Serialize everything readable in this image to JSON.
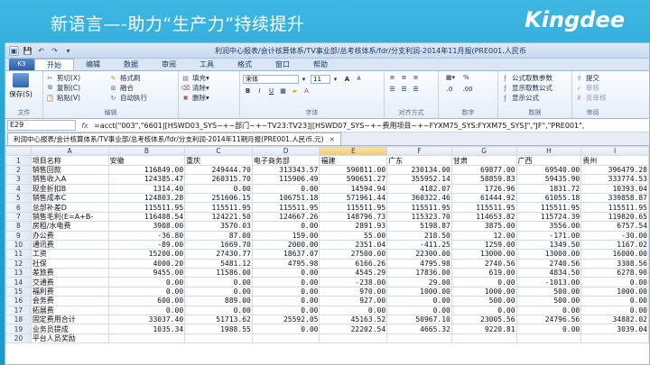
{
  "slide": {
    "title": "新语言—-助力“生产力”持续提升",
    "brand": "Kingdee"
  },
  "window": {
    "title": "利润中心报表/会计核算体系/TV事业部/总考核体系/fdr/分支利润-2014年11月报(PRE001.人民币"
  },
  "ribbon": {
    "app_button": "K3",
    "tabs": [
      "开始",
      "编辑",
      "数据",
      "审阅",
      "工具",
      "格式",
      "窗口",
      "帮助"
    ],
    "active_tab": "开始",
    "save_label": "保存(S)",
    "file_group": "文件",
    "edit_group": "编辑",
    "font_group": "字体",
    "align_group": "对齐方式",
    "number_group": "数字",
    "data_group": "数据",
    "review_group": "审阅",
    "cut": "剪切(X)",
    "copy": "复制(C)",
    "paste": "粘贴(V)",
    "format_painter": "格式刷",
    "merge": "融合",
    "wrap": "自动执行",
    "fill": "填充",
    "clear": "清除",
    "delete": "删除",
    "font_name": "宋体",
    "font_size": "11",
    "font_grow": "A",
    "font_shrink": "A",
    "percent": "%",
    "formula_params": "公式取数参数",
    "show_formula": "显示取数公式",
    "show_formula2": "显示公式",
    "submit": "提交",
    "audit": "审核",
    "unaudit": "反审核"
  },
  "formula_bar": {
    "cell": "E29",
    "fx": "fx",
    "text": "=acct(\"003\",\"6601|[HSWD03_SYS~+~部门~+~TV23:TV23]|[HSWD07_SYS~+~费用项目~+~FYXM75_SYS:FYXM75_SYS]\",\"JF\",\"PRE001\","
  },
  "doc_tab": {
    "label": "利润中心报表/会计核算体系/TV事业部/总考核体系/fdr/分支利润-2014年11期月报(PRE001.人民币.元)",
    "close": "×"
  },
  "columns": [
    "A",
    "B",
    "C",
    "D",
    "E",
    "F",
    "G",
    "H",
    "I"
  ],
  "rows": [
    {
      "n": "1",
      "cells": [
        "项目名称",
        "安徽",
        "重庆",
        "电子商务部",
        "福建",
        "广东",
        "甘肃",
        "广西",
        "贵州"
      ]
    },
    {
      "n": "2",
      "cells": [
        "销售回款",
        "116849.00",
        "249444.70",
        "313343.57",
        "590811.00",
        "230134.00",
        "69877.00",
        "69540.00",
        "396479.28"
      ]
    },
    {
      "n": "3",
      "cells": [
        "销售收入A",
        "124385.47",
        "260315.70",
        "115906.49",
        "590651.27",
        "355952.14",
        "58859.83",
        "59435.90",
        "333774.53"
      ]
    },
    {
      "n": "4",
      "cells": [
        "现金折扣B",
        "1314.40",
        "0.00",
        "0.00",
        "14594.94",
        "4182.07",
        "1726.96",
        "1831.72",
        "10393.04"
      ]
    },
    {
      "n": "5",
      "cells": [
        "销售成本C",
        "124803.28",
        "251606.15",
        "106751.18",
        "571961.44",
        "360322.46",
        "61444.92",
        "61055.18",
        "339858.87"
      ]
    },
    {
      "n": "6",
      "cells": [
        "总部补差D",
        "115511.95",
        "115511.95",
        "115511.95",
        "115511.95",
        "115511.95",
        "115511.95",
        "115511.95",
        "115511.95"
      ]
    },
    {
      "n": "7",
      "cells": [
        "销售毛利(E=A+B-",
        "116408.54",
        "124221.50",
        "124667.26",
        "148796.73",
        "115323.70",
        "114653.82",
        "115724.39",
        "119820.65"
      ]
    },
    {
      "n": "8",
      "cells": [
        "房租/水电费",
        "3908.00",
        "3570.03",
        "0.00",
        "2891.93",
        "5198.87",
        "3875.00",
        "3556.00",
        "6757.54"
      ]
    },
    {
      "n": "9",
      "cells": [
        "办公费",
        "-36.80",
        "87.00",
        "159.00",
        "55.00",
        "218.50",
        "12.00",
        "-171.00",
        "-30.00"
      ]
    },
    {
      "n": "10",
      "cells": [
        "通讯费",
        "-89.00",
        "1669.70",
        "2000.00",
        "2351.04",
        "-411.25",
        "1259.00",
        "1349.50",
        "1167.02"
      ]
    },
    {
      "n": "11",
      "cells": [
        "工资",
        "15200.00",
        "27430.77",
        "18637.07",
        "27500.00",
        "22300.00",
        "13000.00",
        "13000.00",
        "16000.00"
      ]
    },
    {
      "n": "12",
      "cells": [
        "社保",
        "4000.20",
        "5481.12",
        "4795.98",
        "6166.26",
        "4795.98",
        "2740.56",
        "2740.56",
        "3308.56"
      ]
    },
    {
      "n": "13",
      "cells": [
        "差旅费",
        "9455.00",
        "11586.00",
        "0.00",
        "4545.29",
        "17836.00",
        "619.00",
        "4834.50",
        "6278.90"
      ]
    },
    {
      "n": "14",
      "cells": [
        "交通费",
        "0.00",
        "0.00",
        "0.00",
        "-238.00",
        "29.00",
        "0.00",
        "-1013.00",
        "0.00"
      ]
    },
    {
      "n": "15",
      "cells": [
        "福利费",
        "0.00",
        "0.00",
        "0.00",
        "970.00",
        "1000.00",
        "1000.00",
        "500.00",
        "1000.00"
      ]
    },
    {
      "n": "16",
      "cells": [
        "会务费",
        "600.00",
        "889.00",
        "0.00",
        "927.00",
        "0.00",
        "500.00",
        "500.00",
        "0.00"
      ]
    },
    {
      "n": "17",
      "cells": [
        "拓展费",
        "0.00",
        "0.00",
        "0.00",
        "0.00",
        "0.00",
        "0.00",
        "0.00",
        "0.00"
      ]
    },
    {
      "n": "18",
      "cells": [
        "固定费用合计",
        "33037.40",
        "51713.62",
        "25592.05",
        "45163.52",
        "50967.10",
        "23005.56",
        "24796.56",
        "34882.02"
      ]
    },
    {
      "n": "19",
      "cells": [
        "业务员提成",
        "1035.34",
        "1988.55",
        "0.00",
        "22202.54",
        "4665.32",
        "9220.81",
        "0.00",
        "3039.04"
      ]
    },
    {
      "n": "20",
      "cells": [
        "平台人员奖励",
        "",
        "",
        "",
        "",
        "",
        "",
        "",
        ""
      ]
    }
  ],
  "selected_column": "E"
}
